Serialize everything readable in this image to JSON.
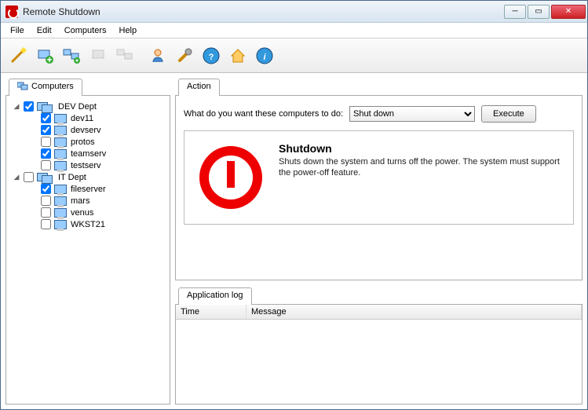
{
  "window": {
    "title": "Remote Shutdown"
  },
  "menu": {
    "file": "File",
    "edit": "Edit",
    "computers": "Computers",
    "help": "Help"
  },
  "tabs": {
    "computers": "Computers",
    "action": "Action",
    "log": "Application log"
  },
  "tree": {
    "groups": [
      {
        "name": "DEV Dept",
        "checked": true,
        "expanded": true,
        "items": [
          {
            "name": "dev11",
            "checked": true
          },
          {
            "name": "devserv",
            "checked": true
          },
          {
            "name": "protos",
            "checked": false
          },
          {
            "name": "teamserv",
            "checked": true
          },
          {
            "name": "testserv",
            "checked": false
          }
        ]
      },
      {
        "name": "IT Dept",
        "checked": false,
        "expanded": true,
        "items": [
          {
            "name": "fileserver",
            "checked": true
          },
          {
            "name": "mars",
            "checked": false
          },
          {
            "name": "venus",
            "checked": false
          },
          {
            "name": "WKST21",
            "checked": false
          }
        ]
      }
    ]
  },
  "action": {
    "prompt": "What do you want these computers to do:",
    "selected": "Shut down",
    "executeLabel": "Execute",
    "title": "Shutdown",
    "description": "Shuts down the system and turns off the power. The system must support the power-off feature."
  },
  "log": {
    "colTime": "Time",
    "colMessage": "Message"
  }
}
